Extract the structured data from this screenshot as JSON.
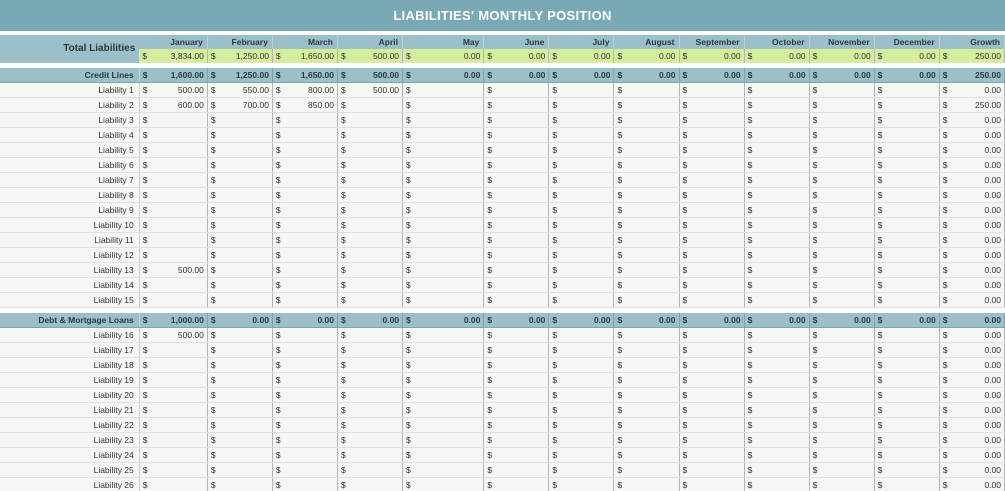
{
  "title": "LIABILITIES' MONTHLY POSITION",
  "currency_symbol": "$",
  "months": [
    "January",
    "February",
    "March",
    "April",
    "May",
    "June",
    "July",
    "August",
    "September",
    "October",
    "November",
    "December",
    "Growth"
  ],
  "total": {
    "label": "Total Liabilities",
    "values": [
      "3,834.00",
      "1,250.00",
      "1,650.00",
      "500.00",
      "0.00",
      "0.00",
      "0.00",
      "0.00",
      "0.00",
      "0.00",
      "0.00",
      "0.00",
      "250.00"
    ]
  },
  "sections": [
    {
      "label": "Credit Lines",
      "totals": [
        "1,600.00",
        "1,250.00",
        "1,650.00",
        "500.00",
        "0.00",
        "0.00",
        "0.00",
        "0.00",
        "0.00",
        "0.00",
        "0.00",
        "0.00",
        "250.00"
      ],
      "rows": [
        {
          "label": "Liability 1",
          "values": [
            "500.00",
            "550.00",
            "800.00",
            "500.00",
            "",
            "",
            "",
            "",
            "",
            "",
            "",
            "",
            "0.00"
          ]
        },
        {
          "label": "Liability 2",
          "values": [
            "600.00",
            "700.00",
            "850.00",
            "",
            "",
            "",
            "",
            "",
            "",
            "",
            "",
            "",
            "250.00"
          ]
        },
        {
          "label": "Liability 3",
          "values": [
            "",
            "",
            "",
            "",
            "",
            "",
            "",
            "",
            "",
            "",
            "",
            "",
            "0.00"
          ]
        },
        {
          "label": "Liability 4",
          "values": [
            "",
            "",
            "",
            "",
            "",
            "",
            "",
            "",
            "",
            "",
            "",
            "",
            "0.00"
          ]
        },
        {
          "label": "Liability 5",
          "values": [
            "",
            "",
            "",
            "",
            "",
            "",
            "",
            "",
            "",
            "",
            "",
            "",
            "0.00"
          ]
        },
        {
          "label": "Liability 6",
          "values": [
            "",
            "",
            "",
            "",
            "",
            "",
            "",
            "",
            "",
            "",
            "",
            "",
            "0.00"
          ]
        },
        {
          "label": "Liability 7",
          "values": [
            "",
            "",
            "",
            "",
            "",
            "",
            "",
            "",
            "",
            "",
            "",
            "",
            "0.00"
          ]
        },
        {
          "label": "Liability 8",
          "values": [
            "",
            "",
            "",
            "",
            "",
            "",
            "",
            "",
            "",
            "",
            "",
            "",
            "0.00"
          ]
        },
        {
          "label": "Liability 9",
          "values": [
            "",
            "",
            "",
            "",
            "",
            "",
            "",
            "",
            "",
            "",
            "",
            "",
            "0.00"
          ]
        },
        {
          "label": "Liability 10",
          "values": [
            "",
            "",
            "",
            "",
            "",
            "",
            "",
            "",
            "",
            "",
            "",
            "",
            "0.00"
          ]
        },
        {
          "label": "Liability 11",
          "values": [
            "",
            "",
            "",
            "",
            "",
            "",
            "",
            "",
            "",
            "",
            "",
            "",
            "0.00"
          ]
        },
        {
          "label": "Liability 12",
          "values": [
            "",
            "",
            "",
            "",
            "",
            "",
            "",
            "",
            "",
            "",
            "",
            "",
            "0.00"
          ]
        },
        {
          "label": "Liability 13",
          "values": [
            "500.00",
            "",
            "",
            "",
            "",
            "",
            "",
            "",
            "",
            "",
            "",
            "",
            "0.00"
          ]
        },
        {
          "label": "Liability 14",
          "values": [
            "",
            "",
            "",
            "",
            "",
            "",
            "",
            "",
            "",
            "",
            "",
            "",
            "0.00"
          ]
        },
        {
          "label": "Liability 15",
          "values": [
            "",
            "",
            "",
            "",
            "",
            "",
            "",
            "",
            "",
            "",
            "",
            "",
            "0.00"
          ]
        }
      ]
    },
    {
      "label": "Debt & Mortgage Loans",
      "totals": [
        "1,000.00",
        "0.00",
        "0.00",
        "0.00",
        "0.00",
        "0.00",
        "0.00",
        "0.00",
        "0.00",
        "0.00",
        "0.00",
        "0.00",
        "0.00"
      ],
      "rows": [
        {
          "label": "Liability 16",
          "values": [
            "500.00",
            "",
            "",
            "",
            "",
            "",
            "",
            "",
            "",
            "",
            "",
            "",
            "0.00"
          ]
        },
        {
          "label": "Liability 17",
          "values": [
            "",
            "",
            "",
            "",
            "",
            "",
            "",
            "",
            "",
            "",
            "",
            "",
            "0.00"
          ]
        },
        {
          "label": "Liability 18",
          "values": [
            "",
            "",
            "",
            "",
            "",
            "",
            "",
            "",
            "",
            "",
            "",
            "",
            "0.00"
          ]
        },
        {
          "label": "Liability 19",
          "values": [
            "",
            "",
            "",
            "",
            "",
            "",
            "",
            "",
            "",
            "",
            "",
            "",
            "0.00"
          ]
        },
        {
          "label": "Liability 20",
          "values": [
            "",
            "",
            "",
            "",
            "",
            "",
            "",
            "",
            "",
            "",
            "",
            "",
            "0.00"
          ]
        },
        {
          "label": "Liability 21",
          "values": [
            "",
            "",
            "",
            "",
            "",
            "",
            "",
            "",
            "",
            "",
            "",
            "",
            "0.00"
          ]
        },
        {
          "label": "Liability 22",
          "values": [
            "",
            "",
            "",
            "",
            "",
            "",
            "",
            "",
            "",
            "",
            "",
            "",
            "0.00"
          ]
        },
        {
          "label": "Liability 23",
          "values": [
            "",
            "",
            "",
            "",
            "",
            "",
            "",
            "",
            "",
            "",
            "",
            "",
            "0.00"
          ]
        },
        {
          "label": "Liability 24",
          "values": [
            "",
            "",
            "",
            "",
            "",
            "",
            "",
            "",
            "",
            "",
            "",
            "",
            "0.00"
          ]
        },
        {
          "label": "Liability 25",
          "values": [
            "",
            "",
            "",
            "",
            "",
            "",
            "",
            "",
            "",
            "",
            "",
            "",
            "0.00"
          ]
        },
        {
          "label": "Liability 26",
          "values": [
            "",
            "",
            "",
            "",
            "",
            "",
            "",
            "",
            "",
            "",
            "",
            "",
            "0.00"
          ]
        }
      ]
    }
  ]
}
